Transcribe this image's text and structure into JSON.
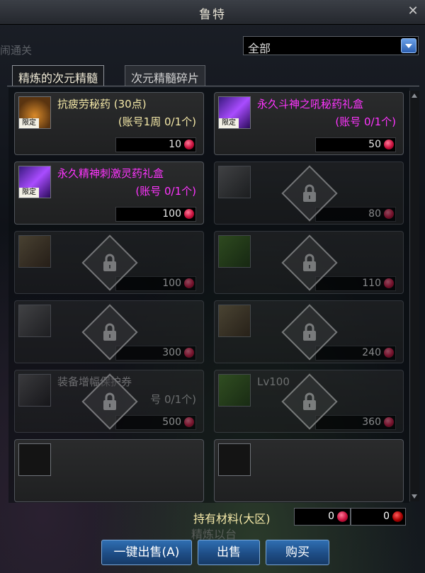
{
  "window": {
    "title": "鲁特"
  },
  "ghost_left_text": "闹通关",
  "filter": {
    "selected": "全部"
  },
  "tabs": [
    {
      "label": "精炼的次元精髓",
      "active": true
    },
    {
      "label": "次元精髓碎片",
      "active": false
    }
  ],
  "items": [
    {
      "name": "抗疲劳秘药 (30点)",
      "sub": "(账号1周 0/1个)",
      "price": "10",
      "name_color": "yellow",
      "tag": "限定",
      "icon": "potion-icon",
      "locked": false
    },
    {
      "name": "永久斗神之吼秘药礼盒",
      "sub": "(账号 0/1个)",
      "price": "50",
      "name_color": "magenta",
      "tag": "限定",
      "icon": "gift-box-icon",
      "locked": false
    },
    {
      "name": "永久精神刺激灵药礼盒",
      "sub": "(账号 0/1个)",
      "price": "100",
      "name_color": "magenta",
      "tag": "限定",
      "icon": "gift-box-icon",
      "locked": false
    },
    {
      "name": "",
      "sub": "",
      "price": "80",
      "name_color": "grey",
      "tag": "",
      "icon": "upgrade-scroll-icon",
      "locked": true
    },
    {
      "name": "",
      "sub": "",
      "price": "100",
      "name_color": "grey",
      "tag": "",
      "icon": "jewel-box-icon",
      "locked": true
    },
    {
      "name": "",
      "sub": "",
      "price": "110",
      "name_color": "grey",
      "tag": "",
      "icon": "book-icon",
      "locked": true
    },
    {
      "name": "",
      "sub": "",
      "price": "300",
      "name_color": "grey",
      "tag": "",
      "icon": "upgrade-scroll-icon",
      "locked": true
    },
    {
      "name": "",
      "sub": "",
      "price": "240",
      "name_color": "grey",
      "tag": "",
      "icon": "jewel-box-icon",
      "locked": true
    },
    {
      "name": "装备增幅保护券",
      "sub": "号 0/1个)",
      "price": "500",
      "name_color": "grey",
      "tag": "",
      "icon": "protection-ticket-icon",
      "locked": true
    },
    {
      "name": "Lv100",
      "sub": "",
      "price": "360",
      "name_color": "grey",
      "tag": "",
      "icon": "book-icon",
      "locked": true
    }
  ],
  "holdings": {
    "label": "持有材料(大区)",
    "value1": "0",
    "value2": "0"
  },
  "bottom_bg_text": "精炼以台",
  "buttons": {
    "sell_all": "一键出售(A)",
    "sell": "出售",
    "buy": "购买"
  },
  "colors": {
    "button_blue": "#1e4d86",
    "name_yellow": "#f5e9a8",
    "name_magenta": "#ff35ff"
  }
}
